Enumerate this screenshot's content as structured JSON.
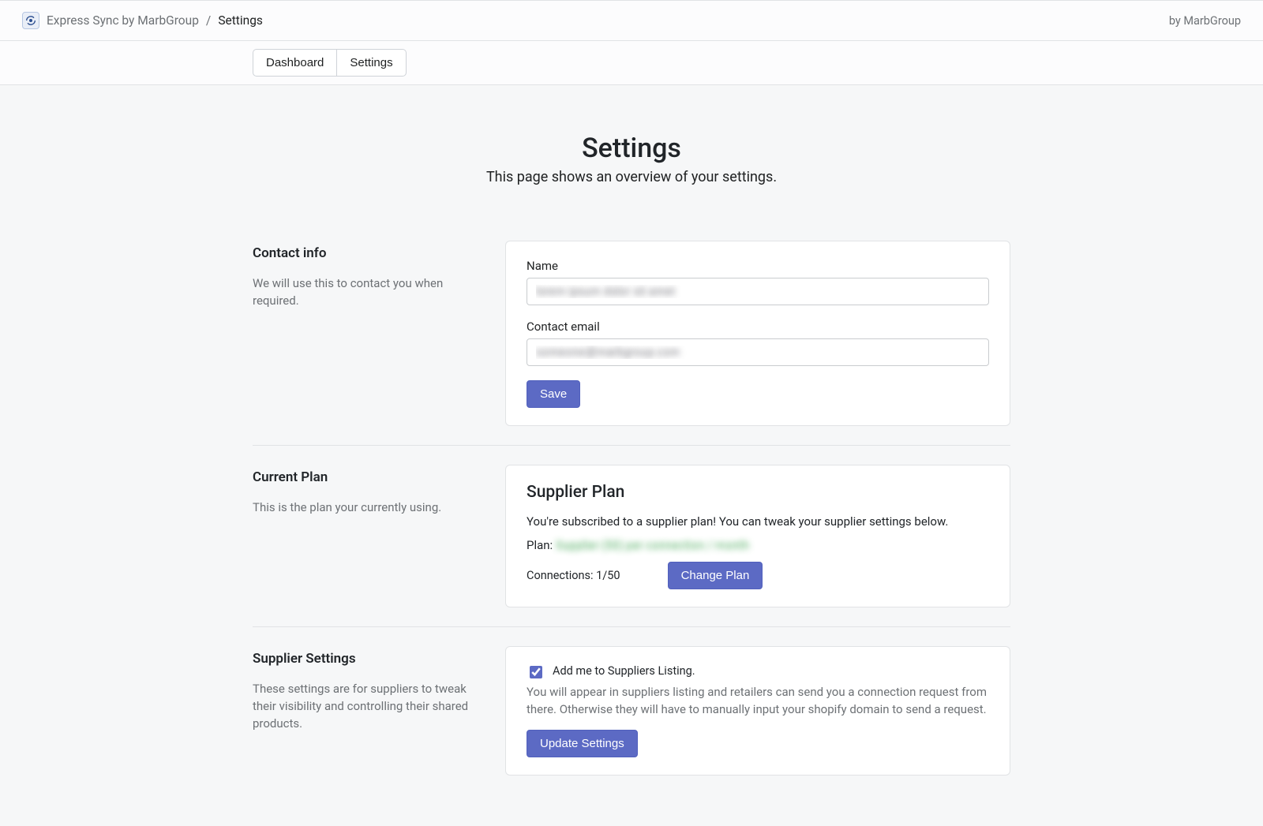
{
  "header": {
    "app_name": "Express Sync by MarbGroup",
    "sep": "/",
    "current": "Settings",
    "byline": "by MarbGroup"
  },
  "tabs": {
    "dashboard": "Dashboard",
    "settings": "Settings"
  },
  "page": {
    "title": "Settings",
    "subtitle": "This page shows an overview of your settings."
  },
  "contact": {
    "heading": "Contact info",
    "desc": "We will use this to contact you when required.",
    "name_label": "Name",
    "name_value": "lorem ipsum dolor sit amet",
    "email_label": "Contact email",
    "email_value": "someone@marbgroup.com",
    "save": "Save"
  },
  "plan": {
    "heading": "Current Plan",
    "desc": "This is the plan your currently using.",
    "title": "Supplier Plan",
    "line": "You're subscribed to a supplier plan! You can tweak your supplier settings below.",
    "plan_label": "Plan:",
    "plan_value": "Supplier (50) per connection / month",
    "connections_label": "Connections:",
    "connections_value": "1/50",
    "change": "Change Plan"
  },
  "supplier": {
    "heading": "Supplier Settings",
    "desc": "These settings are for suppliers to tweak their visibility and controlling their shared products.",
    "listing_label": "Add me to Suppliers Listing.",
    "listing_help": "You will appear in suppliers listing and retailers can send you a connection request from there. Otherwise they will have to manually input your shopify domain to send a request.",
    "update": "Update Settings"
  }
}
